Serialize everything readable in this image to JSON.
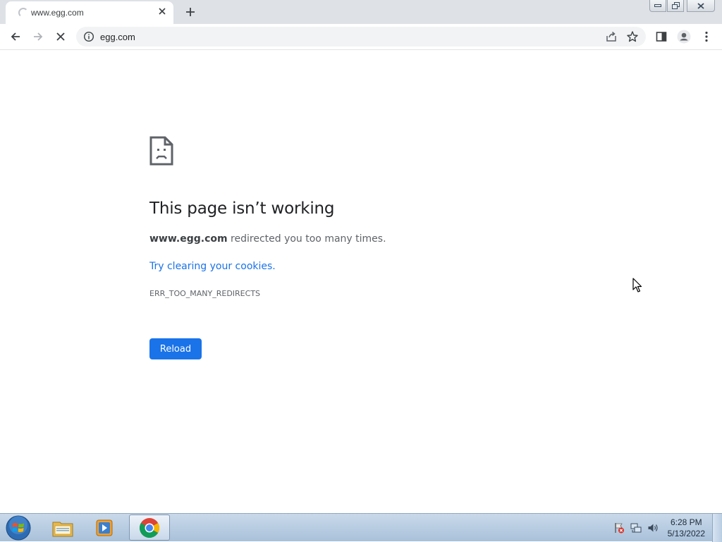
{
  "browser": {
    "tab": {
      "title": "www.egg.com",
      "close_icon": "close-icon",
      "loading_icon": "spinner-icon"
    },
    "new_tab_icon": "plus-icon",
    "window_controls": [
      "minimize-icon",
      "restore-icon",
      "close-icon"
    ],
    "toolbar": {
      "back_icon": "arrow-left-icon",
      "forward_icon": "arrow-right-icon",
      "stop_icon": "close-icon",
      "site_info_icon": "info-icon",
      "url": "egg.com",
      "share_icon": "share-icon",
      "bookmark_icon": "star-icon",
      "side_panel_icon": "side-panel-icon",
      "profile_icon": "person-icon",
      "menu_icon": "kebab-icon"
    }
  },
  "error_page": {
    "icon": "sad-document-icon",
    "heading": "This page isn’t working",
    "domain": "www.egg.com",
    "description": " redirected you too many times.",
    "suggestion_link": "Try clearing your cookies.",
    "error_code": "ERR_TOO_MANY_REDIRECTS",
    "reload_label": "Reload"
  },
  "taskbar": {
    "start_icon": "windows-orb-icon",
    "pinned": [
      "file-explorer-icon",
      "media-player-icon",
      "chrome-icon"
    ],
    "active_item": "chrome-icon",
    "tray_icons": [
      "action-center-flag-icon",
      "network-icon",
      "volume-icon"
    ],
    "clock_time": "6:28 PM",
    "clock_date": "5/13/2022"
  },
  "colors": {
    "accent": "#1a73e8",
    "tab_strip": "#dee1e6",
    "omnibox": "#f1f3f4",
    "heading_text": "#202124",
    "body_text": "#5f6368"
  }
}
